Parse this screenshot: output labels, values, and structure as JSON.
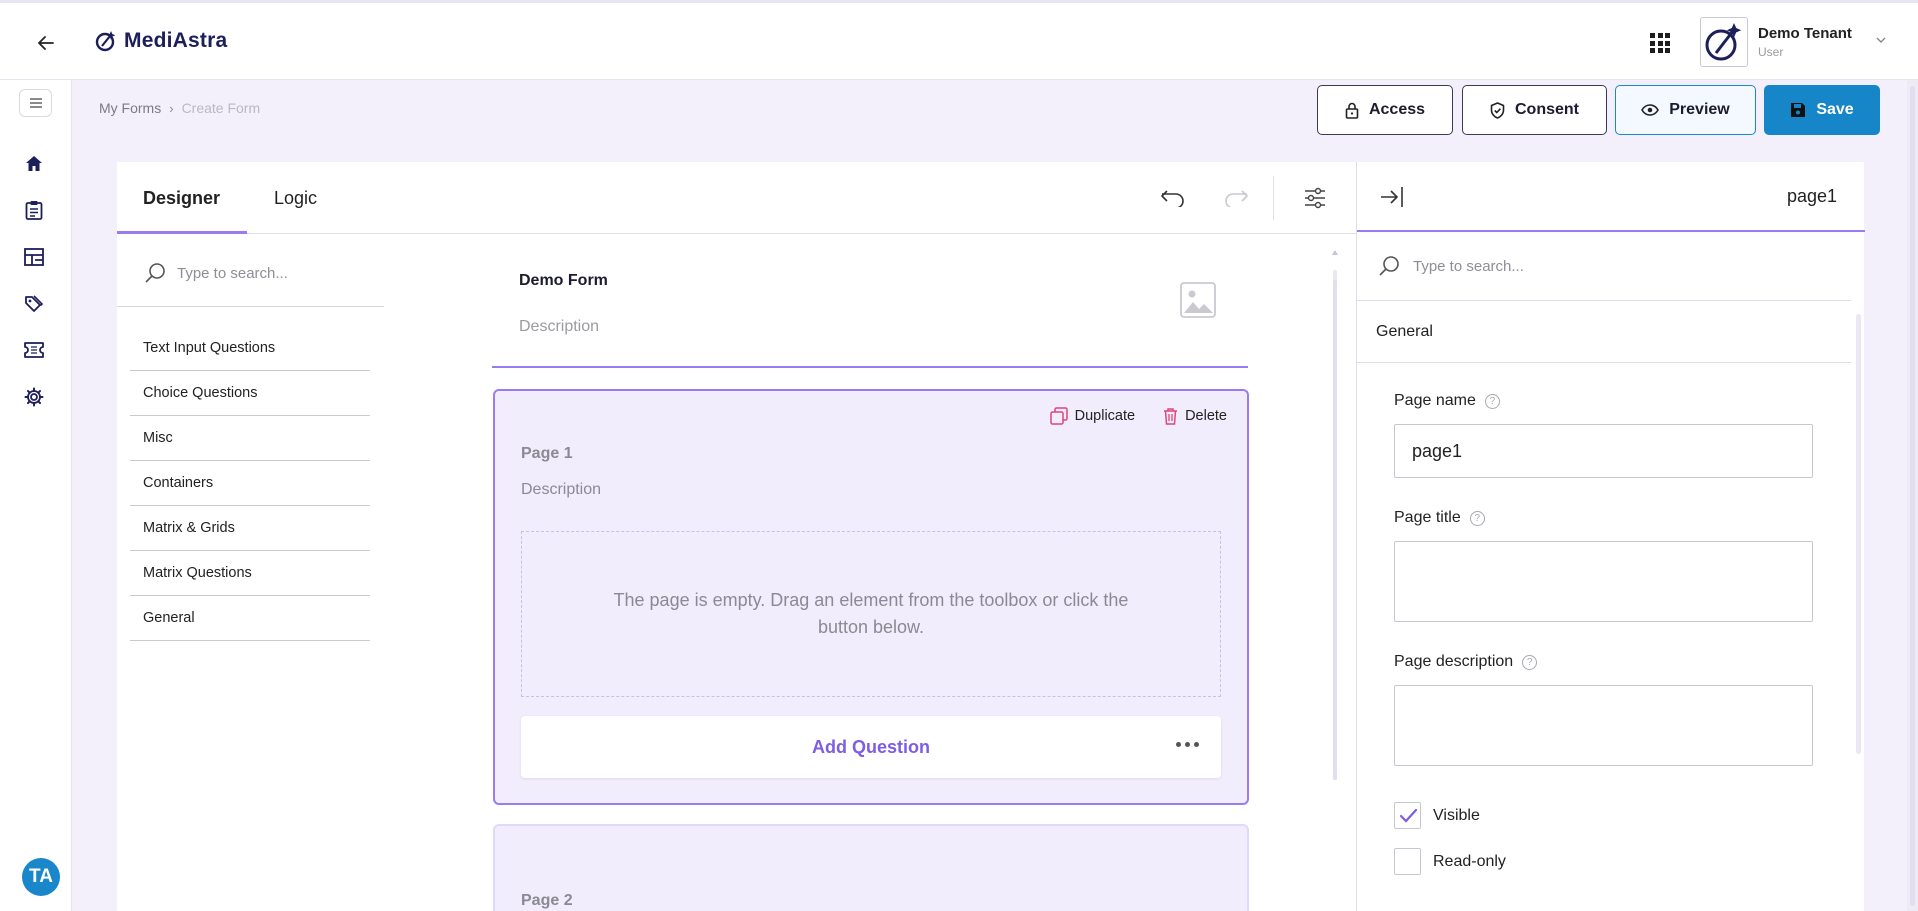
{
  "header": {
    "app_name": "MediAstra",
    "user": {
      "name": "Demo Tenant",
      "role": "User"
    }
  },
  "sidebar": {
    "items": [
      {
        "icon": "home-icon"
      },
      {
        "icon": "clipboard-icon"
      },
      {
        "icon": "dashboard-icon"
      },
      {
        "icon": "tags-icon"
      },
      {
        "icon": "ticket-icon"
      },
      {
        "icon": "gear-icon"
      }
    ],
    "avatar_initials": "TA"
  },
  "breadcrumb": {
    "parent": "My Forms",
    "separator": "›",
    "current": "Create Form"
  },
  "actions": {
    "access": "Access",
    "consent": "Consent",
    "preview": "Preview",
    "save": "Save"
  },
  "tabs": {
    "designer": "Designer",
    "logic": "Logic"
  },
  "toolbox": {
    "search_placeholder": "Type to search...",
    "categories": [
      "Text Input Questions",
      "Choice Questions",
      "Misc",
      "Containers",
      "Matrix & Grids",
      "Matrix Questions",
      "General"
    ]
  },
  "form": {
    "title": "Demo Form",
    "description_placeholder": "Description",
    "pages": [
      {
        "title": "Page 1",
        "description_placeholder": "Description",
        "duplicate_label": "Duplicate",
        "delete_label": "Delete",
        "empty_message": "The page is empty. Drag an element from the toolbox or click the button below.",
        "add_question_label": "Add Question"
      },
      {
        "title": "Page 2"
      }
    ]
  },
  "properties": {
    "selected_name": "page1",
    "search_placeholder": "Type to search...",
    "section": "General",
    "page_name_label": "Page name",
    "page_name_value": "page1",
    "page_title_label": "Page title",
    "page_title_value": "",
    "page_description_label": "Page description",
    "page_description_value": "",
    "visible_label": "Visible",
    "visible_checked": true,
    "readonly_label": "Read-only",
    "readonly_checked": false,
    "help_glyph": "?"
  },
  "colors": {
    "accent": "#9a7cf0",
    "primary": "#1786c8",
    "brand_navy": "#1c1f5a",
    "danger": "#e0457b"
  }
}
